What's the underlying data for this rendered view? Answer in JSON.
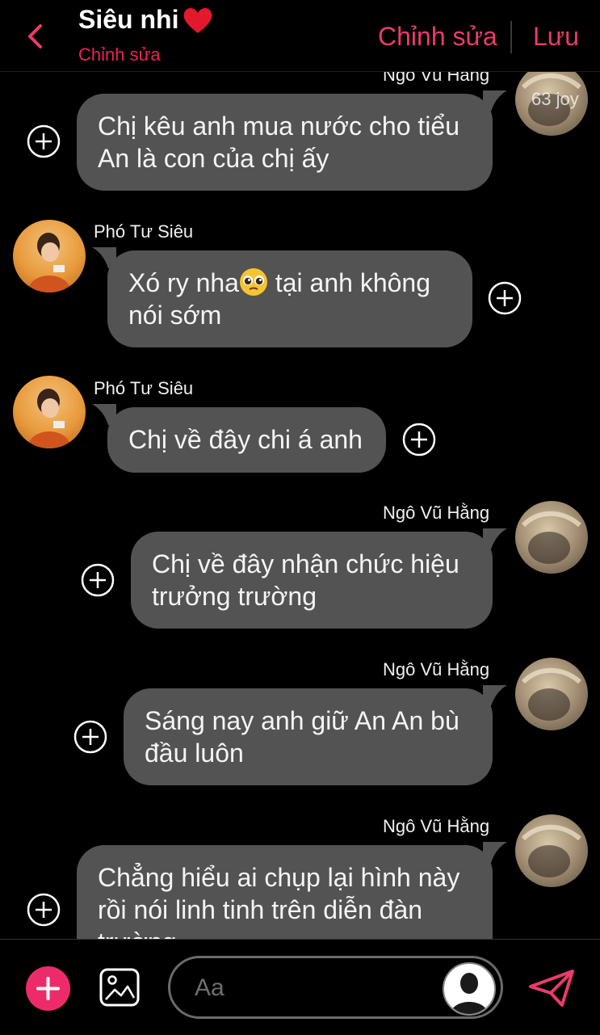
{
  "header": {
    "title": "Siêu nhi",
    "subtitle": "Chỉnh sửa",
    "edit_label": "Chỉnh sửa",
    "save_label": "Lưu",
    "accent": "#ec3a6a"
  },
  "watermark": "63 joy",
  "messages": [
    {
      "sender": "Ngô Vũ Hằng",
      "side": "right",
      "lines": [
        "Chị kêu anh mua nước cho tiểu",
        "An là con của chị ấy"
      ]
    },
    {
      "sender": "Phó Tư Siêu",
      "side": "left",
      "lines": [
        "Xó ry nha",
        " tại anh không",
        "nói sớm"
      ],
      "emoji": "pleading-face-emoji"
    },
    {
      "sender": "Phó Tư Siêu",
      "side": "left",
      "lines": [
        "Chị về đây chi á anh"
      ]
    },
    {
      "sender": "Ngô Vũ Hằng",
      "side": "right",
      "lines": [
        "Chị về đây nhận chức hiệu",
        "trưởng trường"
      ]
    },
    {
      "sender": "Ngô Vũ Hằng",
      "side": "right",
      "lines": [
        "Sáng nay anh giữ An An bù",
        "đầu luôn"
      ]
    },
    {
      "sender": "Ngô Vũ Hằng",
      "side": "right",
      "lines": [
        "Chẳng hiểu ai chụp lại hình này",
        "rồi nói linh tinh trên diễn đàn",
        "trường"
      ]
    }
  ],
  "composer": {
    "placeholder": "Aa",
    "add_icon": "plus-icon",
    "image_icon": "image-icon",
    "send_icon": "send-icon"
  }
}
